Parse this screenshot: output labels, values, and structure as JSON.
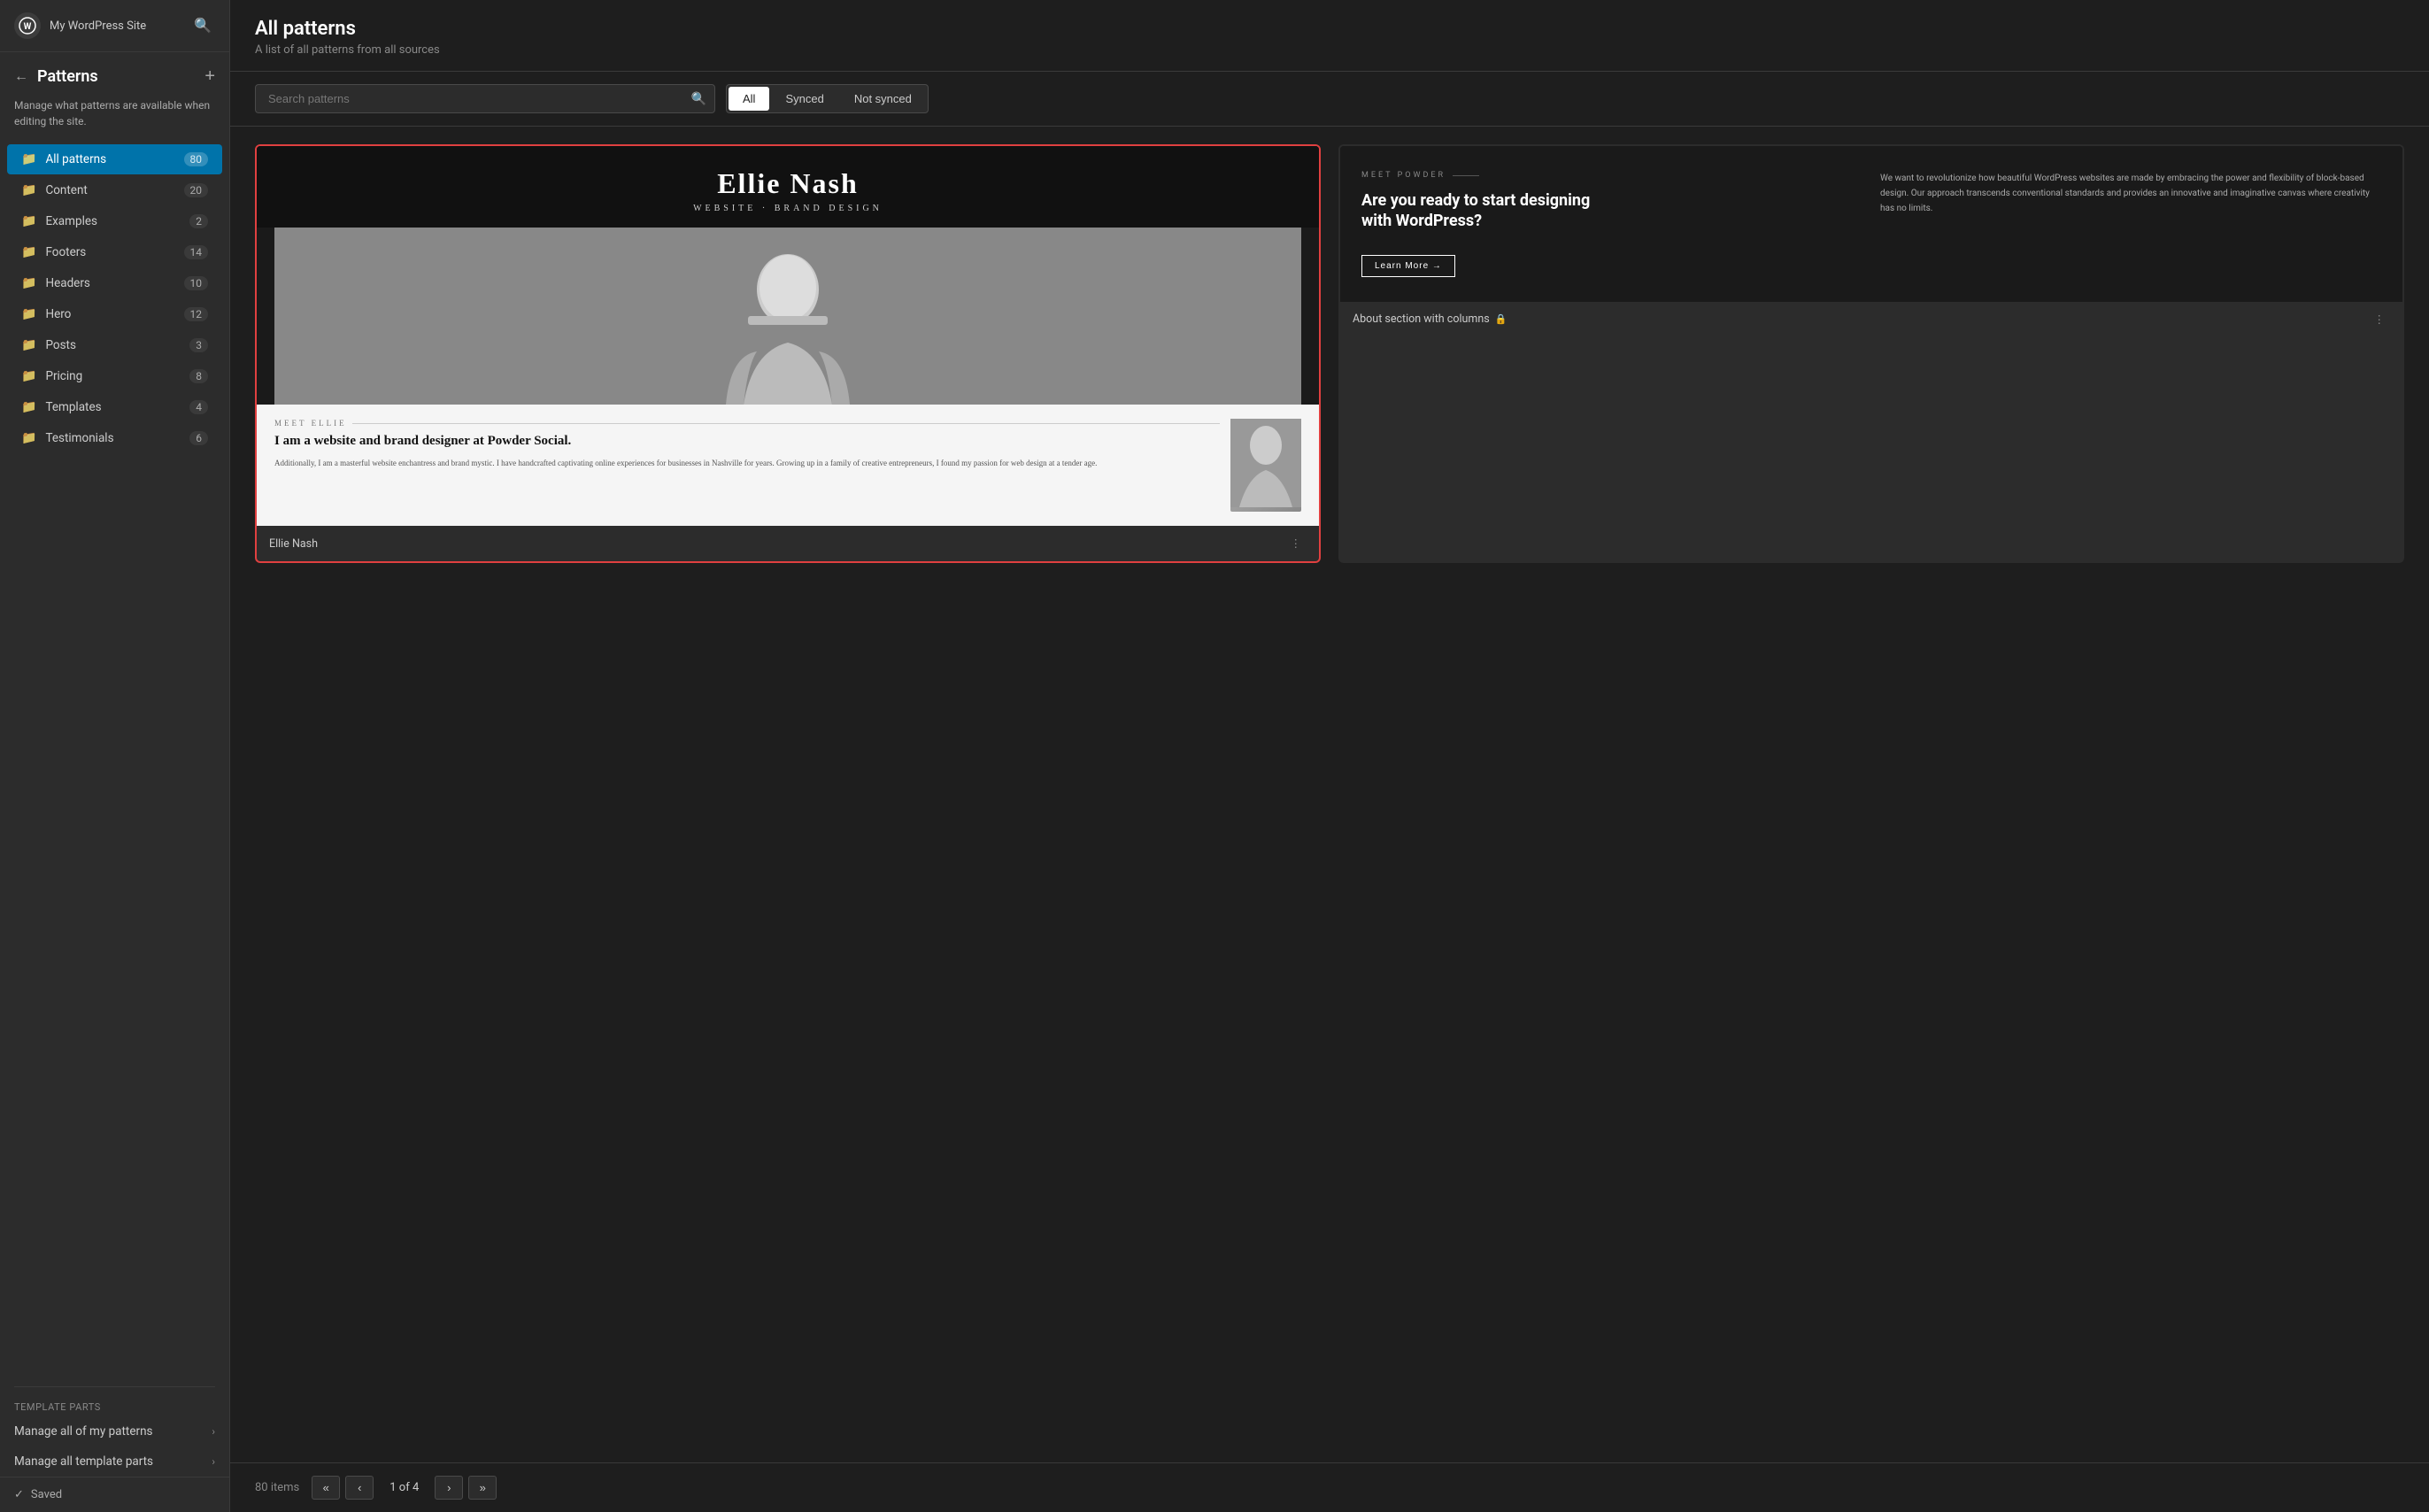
{
  "sidebar": {
    "logo_alt": "WordPress",
    "site_name": "My WordPress Site",
    "back_button_label": "←",
    "title": "Patterns",
    "add_button_label": "+",
    "description": "Manage what patterns are available when editing the site.",
    "nav_items": [
      {
        "id": "all-patterns",
        "label": "All patterns",
        "count": 80,
        "active": true
      },
      {
        "id": "content",
        "label": "Content",
        "count": 20,
        "active": false
      },
      {
        "id": "examples",
        "label": "Examples",
        "count": 2,
        "active": false
      },
      {
        "id": "footers",
        "label": "Footers",
        "count": 14,
        "active": false
      },
      {
        "id": "headers",
        "label": "Headers",
        "count": 10,
        "active": false
      },
      {
        "id": "hero",
        "label": "Hero",
        "count": 12,
        "active": false
      },
      {
        "id": "posts",
        "label": "Posts",
        "count": 3,
        "active": false
      },
      {
        "id": "pricing",
        "label": "Pricing",
        "count": 8,
        "active": false
      },
      {
        "id": "templates",
        "label": "Templates",
        "count": 4,
        "active": false
      },
      {
        "id": "testimonials",
        "label": "Testimonials",
        "count": 6,
        "active": false
      }
    ],
    "section_label": "TEMPLATE PARTS",
    "links": [
      {
        "id": "manage-patterns",
        "label": "Manage all of my patterns"
      },
      {
        "id": "manage-templates",
        "label": "Manage all template parts"
      }
    ],
    "status": "Saved"
  },
  "main": {
    "title": "All patterns",
    "subtitle": "A list of all patterns from all sources",
    "search_placeholder": "Search patterns",
    "filter_tabs": [
      {
        "id": "all",
        "label": "All",
        "active": true
      },
      {
        "id": "synced",
        "label": "Synced",
        "active": false
      },
      {
        "id": "not-synced",
        "label": "Not synced",
        "active": false
      }
    ],
    "patterns": [
      {
        "id": "ellie-nash",
        "selected": true,
        "preview_type": "ellie-nash",
        "label": "Ellie Nash",
        "locked": false
      },
      {
        "id": "about-section",
        "selected": false,
        "preview_type": "about-section",
        "label": "About section with columns",
        "locked": true
      }
    ],
    "ellie_preview": {
      "name": "Ellie Nash",
      "tagline": "WEBSITE · BRAND DESIGN",
      "meet_label": "MEET ELLIE",
      "bottom_title": "I am a website and brand designer at Powder Social.",
      "bottom_body": "Additionally, I am a masterful website enchantress and brand mystic. I have handcrafted captivating online experiences for businesses in Nashville for years. Growing up in a family of creative entrepreneurs, I found my passion for web design at a tender age."
    },
    "about_preview": {
      "meet_label": "MEET POWDER",
      "headline": "Are you ready to start designing with WordPress?",
      "body": "We want to revolutionize how beautiful WordPress websites are made by embracing the power and flexibility of block-based design. Our approach transcends conventional standards and provides an innovative and imaginative canvas where creativity has no limits.",
      "learn_more": "Learn More →"
    },
    "pagination": {
      "total": "80 items",
      "first_label": "«",
      "prev_label": "‹",
      "current_page": "1 of 4",
      "next_label": "›",
      "last_label": "»"
    }
  }
}
